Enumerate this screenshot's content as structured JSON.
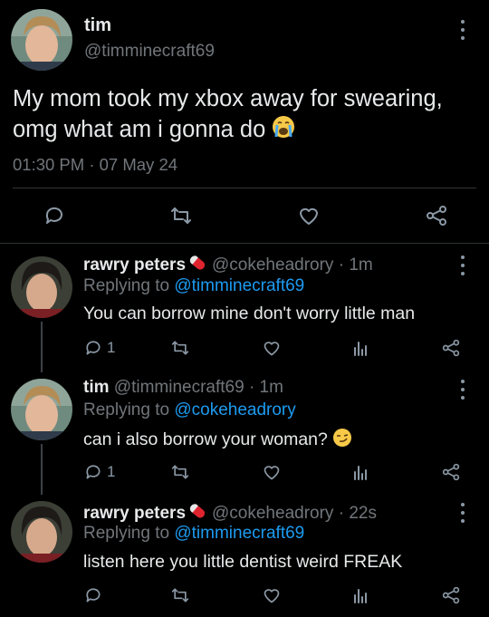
{
  "main_tweet": {
    "display_name": "tim",
    "handle": "@timminecraft69",
    "text": "My mom took my xbox away for swearing, omg what am i gonna do",
    "emoji": "crying-face",
    "time": "01:30 PM",
    "separator": "·",
    "date": "07 May 24"
  },
  "replies": [
    {
      "display_name": "rawry peters",
      "badge_icon": "pill-icon",
      "handle": "@cokeheadrory",
      "time_ago": "· 1m",
      "replying_prefix": "Replying to",
      "replying_to": "@timminecraft69",
      "text": "You can borrow mine don't worry little man",
      "reply_count": "1"
    },
    {
      "display_name": "tim",
      "handle": "@timminecraft69",
      "time_ago": "· 1m",
      "replying_prefix": "Replying to",
      "replying_to": "@cokeheadrory",
      "text": "can i also borrow your woman?",
      "emoji": "smirking-face",
      "reply_count": "1"
    },
    {
      "display_name": "rawry peters",
      "badge_icon": "pill-icon",
      "handle": "@cokeheadrory",
      "time_ago": "· 22s",
      "replying_prefix": "Replying to",
      "replying_to": "@timminecraft69",
      "text": "listen here you little dentist weird FREAK",
      "reply_count": ""
    }
  ],
  "colors": {
    "background": "#000000",
    "text": "#e7e9ea",
    "muted": "#71767b",
    "link": "#1d9bf0",
    "icon": "#8b98a5"
  }
}
